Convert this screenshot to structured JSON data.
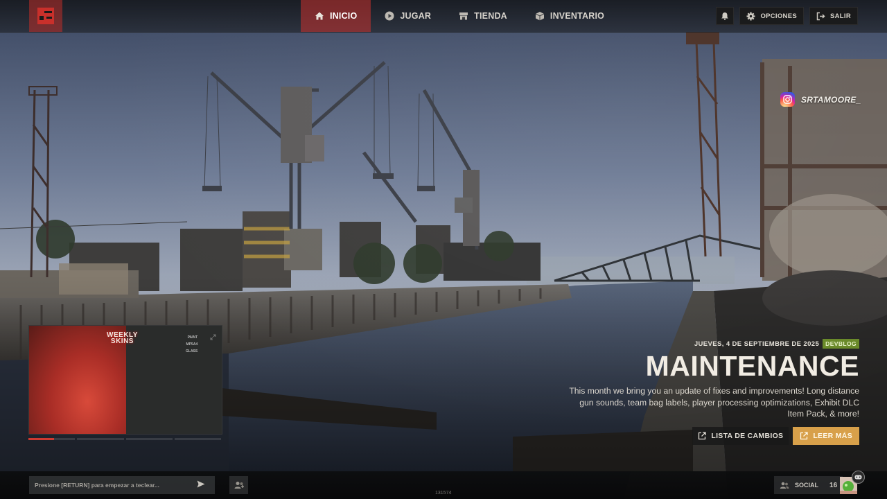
{
  "nav": {
    "items": [
      {
        "label": "INICIO",
        "icon": "home-icon",
        "active": true
      },
      {
        "label": "JUGAR",
        "icon": "play-icon",
        "active": false
      },
      {
        "label": "TIENDA",
        "icon": "store-icon",
        "active": false
      },
      {
        "label": "INVENTARIO",
        "icon": "inventory-icon",
        "active": false
      }
    ],
    "options_label": "OPCIONES",
    "exit_label": "SALIR"
  },
  "instagram": {
    "handle": "SRTAMOORE_"
  },
  "video": {
    "title_line1": "WEEKLY",
    "title_line2": "SKINS",
    "tags": [
      "PAINT",
      "MP5A4",
      "GLASS"
    ],
    "progress_segments": [
      0.55,
      0,
      0,
      0
    ]
  },
  "news": {
    "date": "JUEVES, 4 DE SEPTIEMBRE DE 2025",
    "badge": "DEVBLOG",
    "title": "MAINTENANCE",
    "description": "This month we bring you an update of fixes and improvements! Long distance gun sounds, team bag labels, player processing optimizations, Exhibit DLC Item Pack, & more!",
    "changelog_label": "LISTA DE CAMBIOS",
    "read_more_label": "LEER MÁS"
  },
  "chat": {
    "placeholder": "Presione [RETURN] para empezar a teclear..."
  },
  "build": "131574",
  "social": {
    "label": "SOCIAL",
    "count": "16"
  },
  "colors": {
    "accent_red": "#c8302b",
    "accent_gold": "#d8a04a",
    "devblog_green": "#6a8a2a"
  }
}
